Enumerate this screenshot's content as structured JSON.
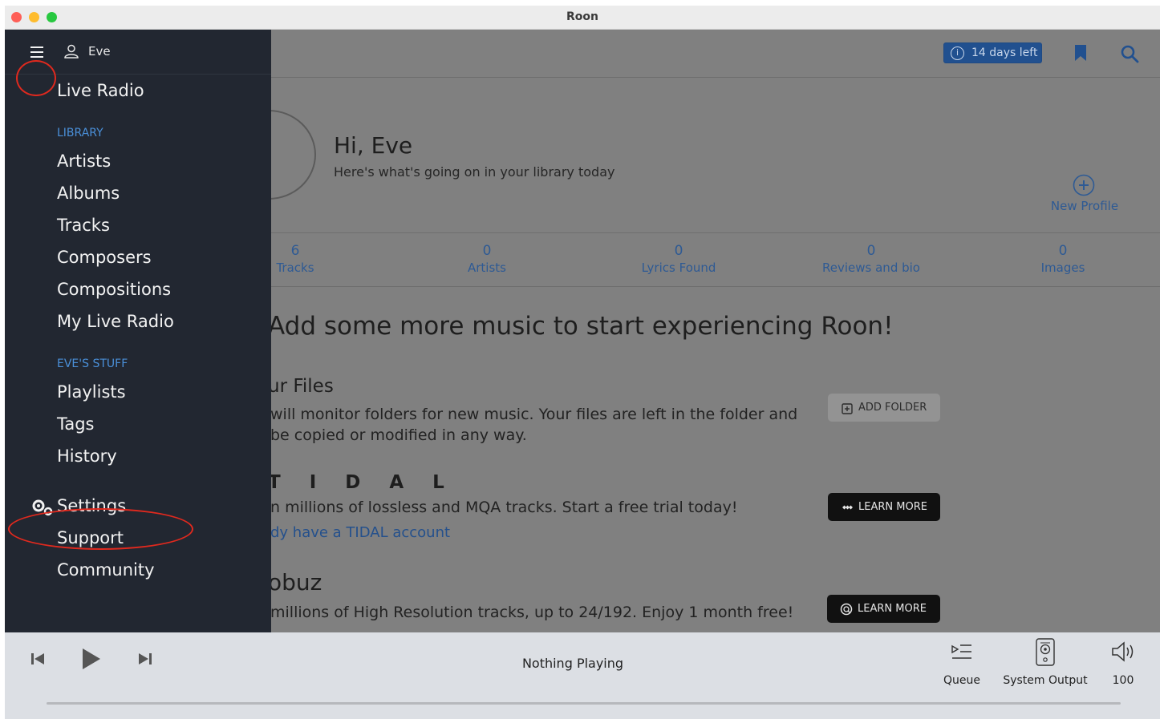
{
  "window": {
    "title": "Roon"
  },
  "topbar": {
    "trial_label": "14 days left",
    "trial_icon": "info-icon"
  },
  "profile": {
    "greeting": "Hi, Eve",
    "subtitle": "Here's what's going on in your library today",
    "new_profile_label": "New Profile"
  },
  "stats": [
    {
      "value": "6",
      "label": "Tracks"
    },
    {
      "value": "0",
      "label": "Artists"
    },
    {
      "value": "0",
      "label": "Lyrics Found"
    },
    {
      "value": "0",
      "label": "Reviews and bio"
    },
    {
      "value": "0",
      "label": "Images"
    }
  ],
  "main": {
    "cta": "Add some more music to start experiencing Roon!",
    "files": {
      "title": "ur Files",
      "line1": "will monitor folders for new music. Your files are left in the folder and",
      "line2": "be copied or modified in any way.",
      "button": "ADD FOLDER"
    },
    "tidal": {
      "title": "T I D A L",
      "line1": "n millions of lossless and MQA tracks. Start a free trial today!",
      "link": "dy have a TIDAL account",
      "button": "LEARN MORE"
    },
    "qobuz": {
      "title": "obuz",
      "line1": "millions of High Resolution tracks, up to 24/192. Enjoy 1 month free!",
      "button": "LEARN MORE"
    }
  },
  "sidebar": {
    "user": "Eve",
    "live_radio": "Live Radio",
    "library_header": "LIBRARY",
    "library_items": [
      "Artists",
      "Albums",
      "Tracks",
      "Composers",
      "Compositions",
      "My Live Radio"
    ],
    "stuff_header": "EVE'S STUFF",
    "stuff_items": [
      "Playlists",
      "Tags",
      "History"
    ],
    "settings": "Settings",
    "support": "Support",
    "community": "Community"
  },
  "player": {
    "status": "Nothing Playing",
    "queue_label": "Queue",
    "output_label": "System Output",
    "volume": "100"
  },
  "colors": {
    "sidebar_bg": "#222731",
    "accent_blue": "#4a8fd8",
    "annotation_red": "#e0291e"
  }
}
